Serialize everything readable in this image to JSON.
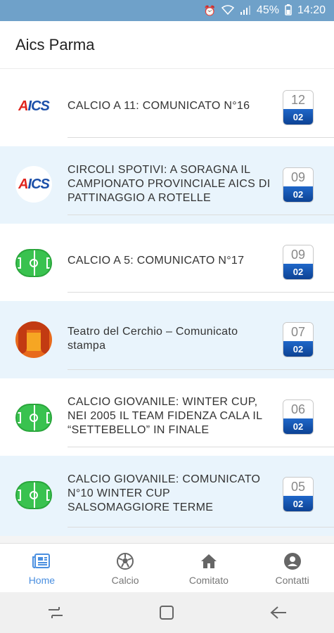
{
  "status_bar": {
    "battery": "45%",
    "time": "14:20"
  },
  "app_bar": {
    "title": "Aics Parma"
  },
  "news": [
    {
      "title": "CALCIO A 11: COMUNICATO N°16",
      "day": "12",
      "month": "02",
      "icon": "aics-logo-icon"
    },
    {
      "title": "CIRCOLI SPOTIVI: A SORAGNA IL CAMPIONATO PROVINCIALE AICS DI PATTINAGGIO A ROTELLE",
      "day": "09",
      "month": "02",
      "icon": "aics-logo-icon"
    },
    {
      "title": "CALCIO A 5: COMUNICATO N°17",
      "day": "09",
      "month": "02",
      "icon": "football-field-icon"
    },
    {
      "title": "Teatro del Cerchio – Comunicato stampa",
      "day": "07",
      "month": "02",
      "icon": "theatre-icon"
    },
    {
      "title": "CALCIO GIOVANILE: WINTER CUP, NEI 2005 IL TEAM FIDENZA CALA IL “SETTEBELLO” IN FINALE",
      "day": "06",
      "month": "02",
      "icon": "football-field-icon"
    },
    {
      "title": "CALCIO GIOVANILE: COMUNICATO N°10 WINTER CUP SALSOMAGGIORE TERME",
      "day": "05",
      "month": "02",
      "icon": "football-field-icon"
    }
  ],
  "bottom_nav": [
    {
      "label": "Home",
      "icon": "newspaper-icon",
      "active": true
    },
    {
      "label": "Calcio",
      "icon": "soccer-ball-icon",
      "active": false
    },
    {
      "label": "Comitato",
      "icon": "home-icon",
      "active": false
    },
    {
      "label": "Contatti",
      "icon": "account-circle-icon",
      "active": false
    }
  ],
  "colors": {
    "accent": "#4a8fe0",
    "status_bar": "#6fa1c9",
    "alt_row": "#e9f4fc",
    "badge_month": "#0b3f8f"
  }
}
